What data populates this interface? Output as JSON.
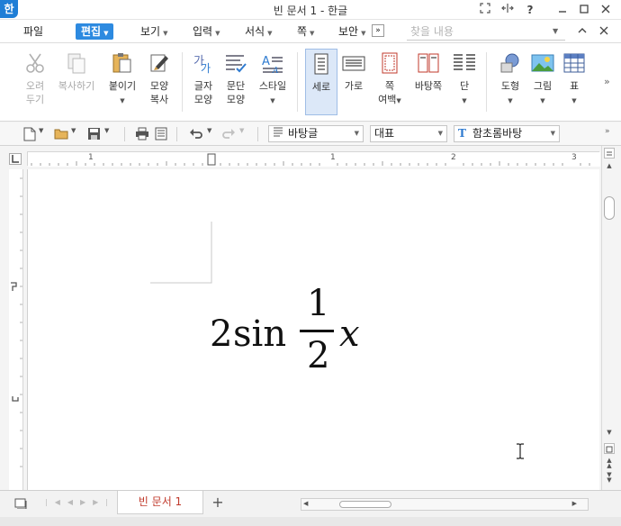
{
  "window": {
    "app_logo": "한",
    "title": "빈 문서 1 - 한글",
    "help": "?"
  },
  "menu": {
    "items": [
      {
        "label": "파일"
      },
      {
        "label": "편집"
      },
      {
        "label": "보기"
      },
      {
        "label": "입력"
      },
      {
        "label": "서식"
      },
      {
        "label": "쪽"
      },
      {
        "label": "보안"
      }
    ],
    "more": "»",
    "search_placeholder": "찾을 내용"
  },
  "ribbon": {
    "buttons": [
      {
        "label": "오려\n두기",
        "icon": "scissors-icon",
        "enabled": false
      },
      {
        "label": "복사하기",
        "icon": "copy-icon",
        "enabled": false
      },
      {
        "label": "붙이기",
        "icon": "paste-icon",
        "enabled": true
      },
      {
        "label": "모양\n복사",
        "icon": "format-painter-icon",
        "enabled": true
      },
      {
        "label": "글자\n모양",
        "icon": "char-shape-icon",
        "enabled": true
      },
      {
        "label": "문단\n모양",
        "icon": "para-shape-icon",
        "enabled": true
      },
      {
        "label": "스타일",
        "icon": "style-icon",
        "enabled": true
      },
      {
        "label": "세로",
        "icon": "portrait-icon",
        "enabled": true,
        "selected": true
      },
      {
        "label": "가로",
        "icon": "landscape-icon",
        "enabled": true
      },
      {
        "label": "쪽\n여백",
        "icon": "margin-icon",
        "enabled": true
      },
      {
        "label": "바탕쪽",
        "icon": "master-page-icon",
        "enabled": true
      },
      {
        "label": "단",
        "icon": "columns-icon",
        "enabled": true
      },
      {
        "label": "도형",
        "icon": "shapes-icon",
        "enabled": true
      },
      {
        "label": "그림",
        "icon": "picture-icon",
        "enabled": true
      },
      {
        "label": "표",
        "icon": "table-icon",
        "enabled": true
      }
    ]
  },
  "toolbar": {
    "style_value": "바탕글",
    "para_value": "대표",
    "font_value": "함초롬바탕",
    "font_badge": "T"
  },
  "ruler": {
    "numbers": [
      "1",
      "1",
      "2",
      "3"
    ]
  },
  "document": {
    "equation": {
      "coefficient": "2",
      "function": "sin",
      "numerator": "1",
      "denominator": "2",
      "variable": "x"
    }
  },
  "status": {
    "tab_label": "빈 문서 1",
    "add_tab": "+"
  }
}
